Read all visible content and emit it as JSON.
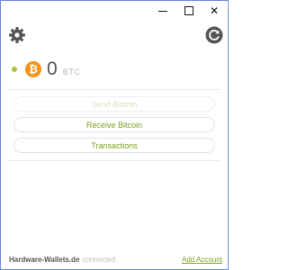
{
  "window": {
    "controls": [
      "minimize",
      "maximize",
      "close"
    ]
  },
  "toolbar": {
    "settings_icon": "gear-icon",
    "refresh_icon": "refresh-icon"
  },
  "balance": {
    "status_color": "#a8c43a",
    "coin_symbol": "₿",
    "amount": "0",
    "unit": "BTC"
  },
  "actions": {
    "send_label": "Send Bitcoin",
    "receive_label": "Receive Bitcoin",
    "transactions_label": "Transactions"
  },
  "footer": {
    "brand": "Hardware-Wallets.de",
    "status": "connected",
    "add_account_label": "Add Account"
  },
  "colors": {
    "accent": "#7da21c",
    "bitcoin": "#f7931a",
    "status_dot": "#a8c43a"
  }
}
